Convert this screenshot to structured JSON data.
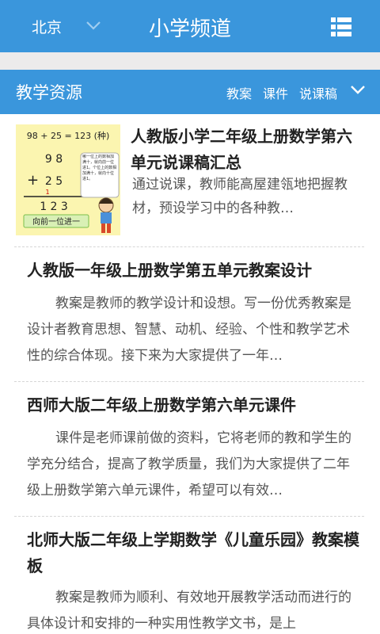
{
  "header": {
    "city": "北京",
    "title": "小学频道",
    "chevron_icon": "chevron-down-icon",
    "menu_icon": "list-menu-icon",
    "bg_color": "#3a96dc"
  },
  "section": {
    "title": "教学资源",
    "links": [
      "教案",
      "课件",
      "说课稿"
    ],
    "chevron_icon": "chevron-down-icon"
  },
  "articles": [
    {
      "title": "人教版小学二年级上册数学第六单元说课稿汇总",
      "summary": "通过说课，教师能高屋建瓴地把握教材，预设学习中的各种教…",
      "thumbnail": {
        "equation": "98 + 25 = 123 (种)",
        "row1": "9 8",
        "op": "+",
        "row2": "2 5",
        "carry": "1",
        "result": "1 2 3",
        "banner": "向前一位进一",
        "note": "哪一位上的数相加满十，就向前一位进1。个位上的数相加满十，就向十位进1。"
      }
    },
    {
      "title": "人教版一年级上册数学第五单元教案设计",
      "summary": "教案是教师的教学设计和设想。写一份优秀教案是设计者教育思想、智慧、动机、经验、个性和教学艺术性的综合体现。接下来为大家提供了一年…"
    },
    {
      "title": "西师大版二年级上册数学第六单元课件",
      "summary": "课件是老师课前做的资料，它将老师的教和学生的学充分结合，提高了教学质量，我们为大家提供了二年级上册数学第六单元课件，希望可以有效…"
    },
    {
      "title": "北师大版二年级上学期数学《儿童乐园》教案模板",
      "summary": "教案是教师为顺利、有效地开展教学活动而进行的具体设计和安排的一种实用性教学文书，是上"
    }
  ]
}
